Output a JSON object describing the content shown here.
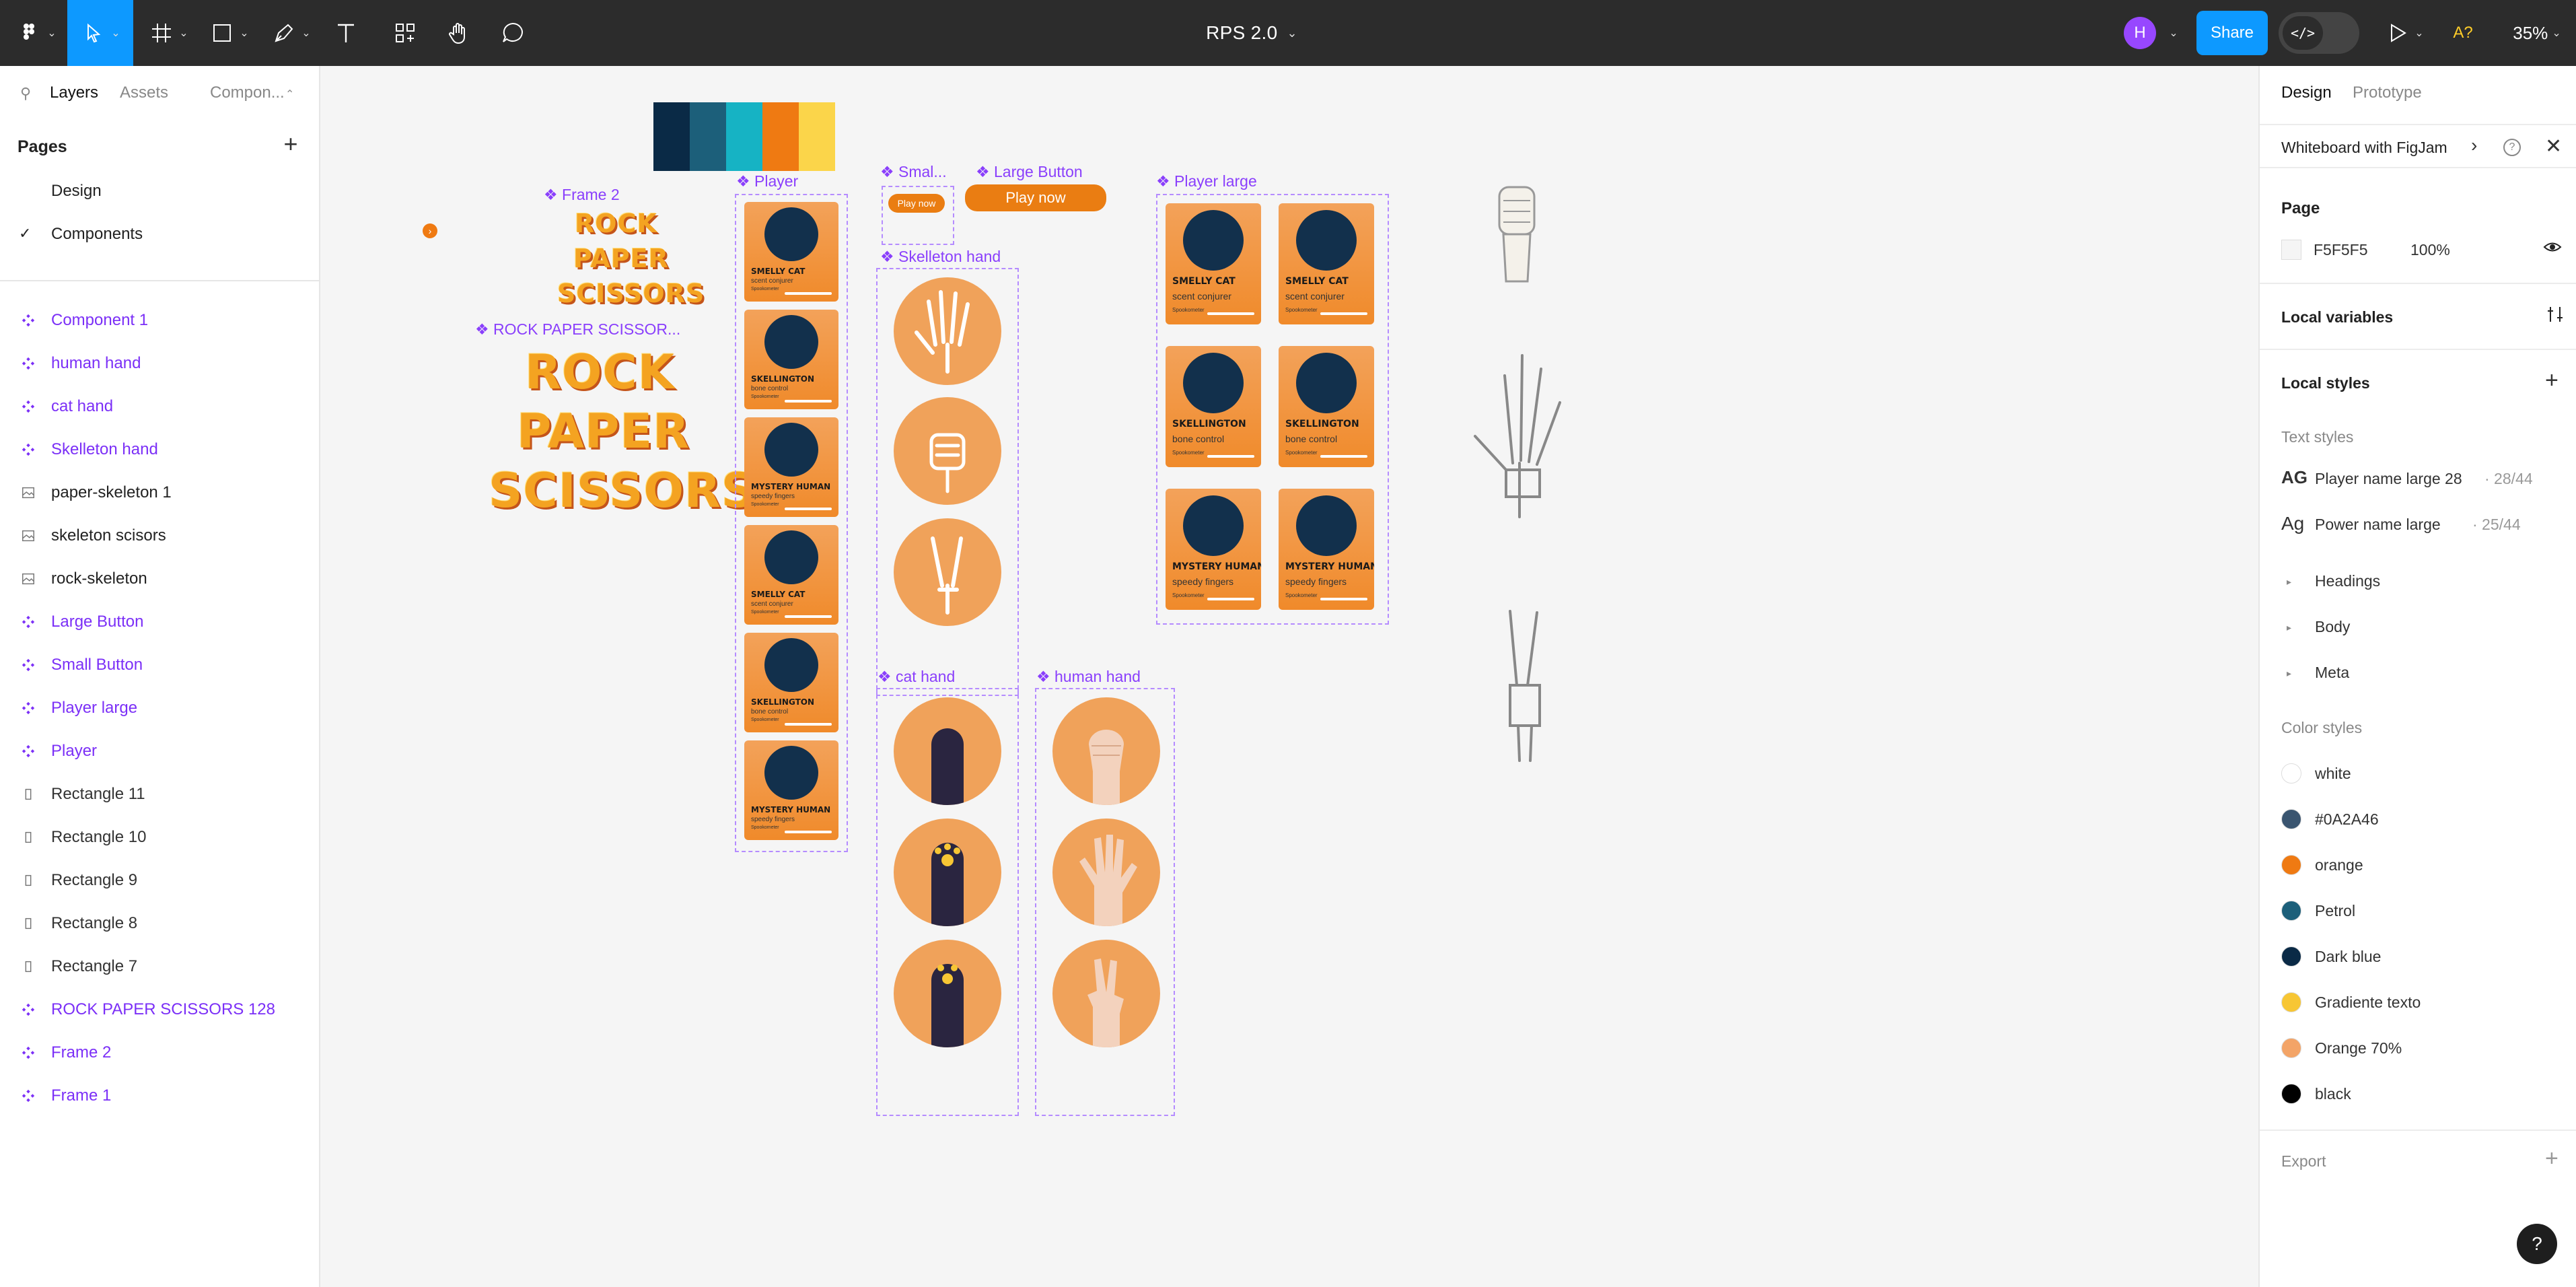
{
  "toolbar": {
    "doc_title": "RPS 2.0",
    "avatar_initial": "H",
    "share_label": "Share",
    "dev_mode_glyph": "</>",
    "a11y_label": "A?",
    "zoom": "35%",
    "tools": [
      "figma-menu-icon",
      "move-icon",
      "frame-icon",
      "rectangle-icon",
      "pen-icon",
      "text-icon",
      "resources-icon",
      "hand-icon",
      "comment-icon"
    ]
  },
  "left_panel": {
    "tabs": [
      "Layers",
      "Assets",
      "Compon..."
    ],
    "pages_header": "Pages",
    "pages": [
      {
        "label": "Design",
        "selected": false
      },
      {
        "label": "Components",
        "selected": true
      }
    ],
    "layers": [
      {
        "label": "Component 1",
        "kind": "component"
      },
      {
        "label": "human hand",
        "kind": "component"
      },
      {
        "label": "cat hand",
        "kind": "component"
      },
      {
        "label": "Skelleton hand",
        "kind": "component"
      },
      {
        "label": "paper-skeleton 1",
        "kind": "image"
      },
      {
        "label": "skeleton scisors",
        "kind": "image"
      },
      {
        "label": "rock-skeleton",
        "kind": "image"
      },
      {
        "label": "Large Button",
        "kind": "component"
      },
      {
        "label": "Small Button",
        "kind": "component"
      },
      {
        "label": "Player large",
        "kind": "component"
      },
      {
        "label": "Player",
        "kind": "component"
      },
      {
        "label": "Rectangle 11",
        "kind": "rect"
      },
      {
        "label": "Rectangle 10",
        "kind": "rect"
      },
      {
        "label": "Rectangle 9",
        "kind": "rect"
      },
      {
        "label": "Rectangle 8",
        "kind": "rect"
      },
      {
        "label": "Rectangle 7",
        "kind": "rect"
      },
      {
        "label": "ROCK PAPER SCISSORS 128",
        "kind": "component"
      },
      {
        "label": "Frame 2",
        "kind": "component"
      },
      {
        "label": "Frame 1",
        "kind": "component"
      }
    ]
  },
  "right_panel": {
    "tabs": [
      "Design",
      "Prototype"
    ],
    "figjam_label": "Whiteboard with FigJam",
    "page_header": "Page",
    "page_color": "F5F5F5",
    "page_opacity": "100%",
    "local_variables": "Local variables",
    "local_styles": "Local styles",
    "text_styles_header": "Text styles",
    "text_styles": [
      {
        "glyph": "AG",
        "name": "Player name large 28",
        "meta": " · 28/44"
      },
      {
        "glyph": "Ag",
        "name": "Power name large",
        "meta": " · 25/44"
      }
    ],
    "text_groups": [
      "Headings",
      "Body",
      "Meta"
    ],
    "color_styles_header": "Color styles",
    "color_styles": [
      {
        "name": "white",
        "color": "#ffffff"
      },
      {
        "name": "#0A2A46",
        "color": "#3a5570"
      },
      {
        "name": "orange",
        "color": "#ef7a12"
      },
      {
        "name": "Petrol",
        "color": "#1c5f7a"
      },
      {
        "name": "Dark blue",
        "color": "#0a2a46"
      },
      {
        "name": "Gradiente texto",
        "color": "#f7c634"
      },
      {
        "name": "Orange 70%",
        "color": "#f3a467"
      },
      {
        "name": "black",
        "color": "#000000"
      }
    ],
    "export_label": "Export"
  },
  "canvas": {
    "frame_labels": {
      "frame2": "Frame 2",
      "rps": "ROCK PAPER SCISSOR...",
      "player": "Player",
      "small": "Smal...",
      "large": "Large Button",
      "skel": "Skelleton hand",
      "player_large": "Player large",
      "cat": "cat hand",
      "human": "human hand"
    },
    "logo_words": [
      "ROCK",
      "PAPER",
      "SCISSORS"
    ],
    "palette": [
      "#0a2a46",
      "#1c5f7a",
      "#16b3c4",
      "#ef7a12",
      "#fbd54a"
    ],
    "small_button": "Play now",
    "large_button": "Play now",
    "players": [
      {
        "name": "SMELLY CAT",
        "power": "scent conjurer",
        "meter": "Spookometer"
      },
      {
        "name": "SKELLINGTON",
        "power": "bone control",
        "meter": "Spookometer"
      },
      {
        "name": "MYSTERY HUMAN",
        "power": "speedy fingers",
        "meter": "Spookometer"
      }
    ]
  }
}
